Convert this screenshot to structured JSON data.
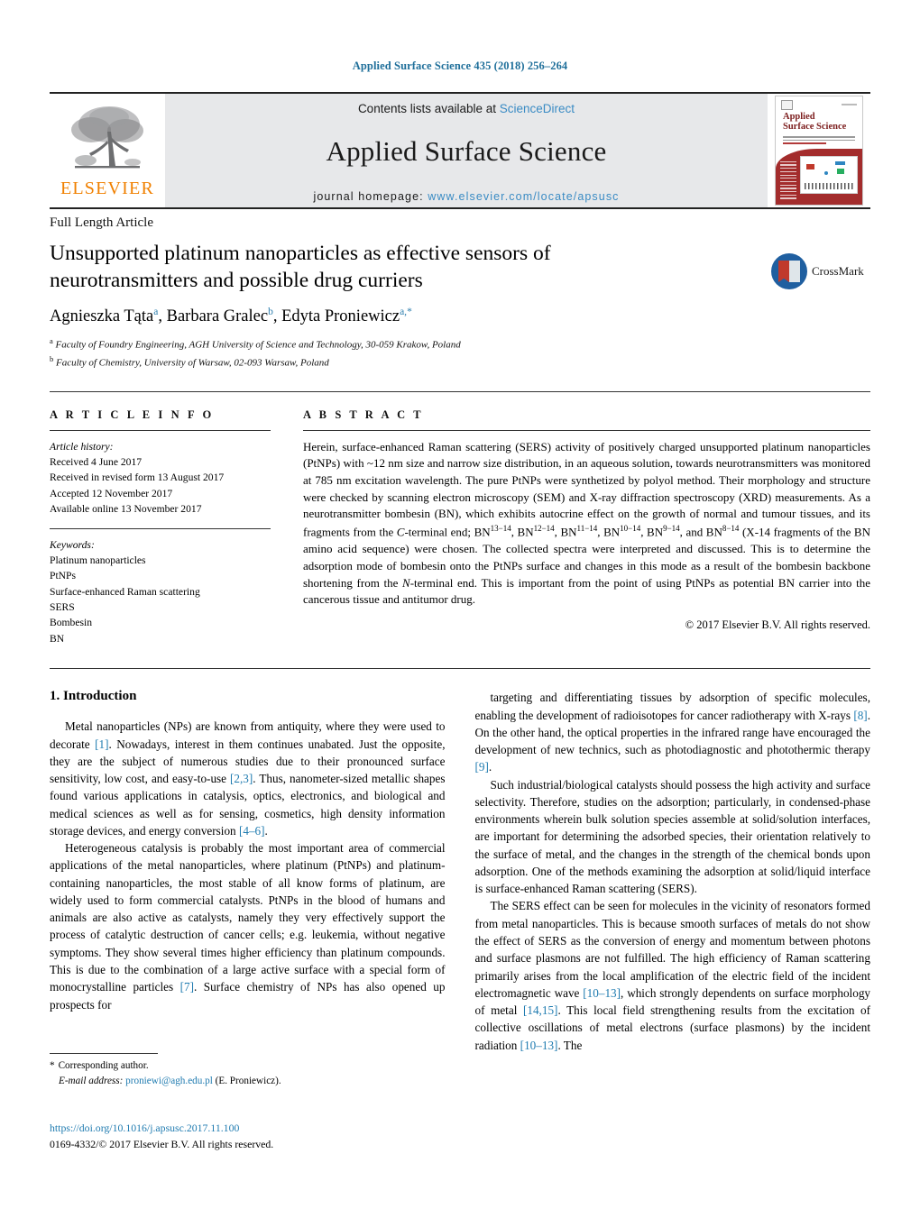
{
  "running_head": "Applied Surface Science 435 (2018) 256–264",
  "masthead": {
    "elsevier_wordmark": "ELSEVIER",
    "contents_prefix": "Contents lists available at ",
    "contents_link": "ScienceDirect",
    "journal_title": "Applied Surface Science",
    "homepage_prefix": "journal homepage: ",
    "homepage_url": "www.elsevier.com/locate/apsusc",
    "cover_title": "Applied\nSurface Science"
  },
  "article": {
    "type": "Full Length Article",
    "title": "Unsupported platinum nanoparticles as effective sensors of neurotransmitters and possible drug curriers",
    "crossmark_label": "CrossMark",
    "authors_html": "Agnieszka Tąta<sup>a</sup>, Barbara Gralec<sup>b</sup>, Edyta Proniewicz<sup>a,</sup><sup>*</sup>",
    "affiliations": [
      "a Faculty of Foundry Engineering, AGH University of Science and Technology, 30-059 Krakow, Poland",
      "b Faculty of Chemistry, University of Warsaw, 02-093 Warsaw, Poland"
    ],
    "affiliation_marks": [
      "a",
      "b"
    ],
    "affiliation_texts": [
      "Faculty of Foundry Engineering, AGH University of Science and Technology, 30-059 Krakow, Poland",
      "Faculty of Chemistry, University of Warsaw, 02-093 Warsaw, Poland"
    ]
  },
  "article_info": {
    "heading": "A R T I C L E   I N F O",
    "history_label": "Article history:",
    "history": [
      "Received 4 June 2017",
      "Received in revised form 13 August 2017",
      "Accepted 12 November 2017",
      "Available online 13 November 2017"
    ],
    "keywords_label": "Keywords:",
    "keywords": [
      "Platinum nanoparticles",
      "PtNPs",
      "Surface-enhanced Raman scattering",
      "SERS",
      "Bombesin",
      "BN"
    ]
  },
  "abstract": {
    "heading": "A B S T R A C T",
    "text_html": "Herein, surface-enhanced Raman scattering (SERS) activity of positively charged unsupported platinum nanoparticles (PtNPs) with ~12 nm size and narrow size distribution, in an aqueous solution, towards neurotransmitters was monitored at 785 nm excitation wavelength. The pure PtNPs were synthetized by polyol method. Their morphology and structure were checked by scanning electron microscopy (SEM) and X-ray diffraction spectroscopy (XRD) measurements. As a neurotransmitter bombesin (BN), which exhibits autocrine effect on the growth of normal and tumour tissues, and its fragments from the <i>C</i>-terminal end; BN<sup>13−14</sup>, BN<sup>12−14</sup>, BN<sup>11−14</sup>, BN<sup>10−14</sup>, BN<sup>9−14</sup>, and BN<sup>8−14</sup> (X-14 fragments of the BN amino acid sequence) were chosen. The collected spectra were interpreted and discussed. This is to determine the adsorption mode of bombesin onto the PtNPs surface and changes in this mode as a result of the bombesin backbone shortening from the <i>N</i>-terminal end. This is important from the point of using PtNPs as potential BN carrier into the cancerous tissue and antitumor drug.",
    "copyright": "© 2017 Elsevier B.V. All rights reserved."
  },
  "introduction": {
    "section_number_title": "1.  Introduction",
    "left_paragraphs_html": [
      "Metal nanoparticles (NPs) are known from antiquity, where they were used to decorate <span class=\"ref\">[1]</span>. Nowadays, interest in them continues unabated. Just the opposite, they are the subject of numerous studies due to their pronounced surface sensitivity, low cost, and easy-to-use <span class=\"ref\">[2,3]</span>. Thus, nanometer-sized metallic shapes found various applications in catalysis, optics, electronics, and biological and medical sciences as well as for sensing, cosmetics, high density information storage devices, and energy conversion <span class=\"ref\">[4–6]</span>.",
      "Heterogeneous catalysis is probably the most important area of commercial applications of the metal nanoparticles, where platinum (PtNPs) and platinum-containing nanoparticles, the most stable of all know forms of platinum, are widely used to form commercial catalysts. PtNPs in the blood of humans and animals are also active as catalysts, namely they very effectively support the process of catalytic destruction of cancer cells; e.g. leukemia, without negative symptoms. They show several times higher efficiency than platinum compounds. This is due to the combination of a large active surface with a special form of monocrystalline particles <span class=\"ref\">[7]</span>. Surface chemistry of NPs has also opened up prospects for"
    ],
    "right_paragraphs_html": [
      "targeting and differentiating tissues by adsorption of specific molecules, enabling the development of radioisotopes for cancer radiotherapy with X-rays <span class=\"ref\">[8]</span>. On the other hand, the optical properties in the infrared range have encouraged the development of new technics, such as photodiagnostic and photothermic therapy <span class=\"ref\">[9]</span>.",
      "Such industrial/biological catalysts should possess the high activity and surface selectivity. Therefore, studies on the adsorption; particularly, in condensed-phase environments wherein bulk solution species assemble at solid/solution interfaces, are important for determining the adsorbed species, their orientation relatively to the surface of metal, and the changes in the strength of the chemical bonds upon adsorption. One of the methods examining the adsorption at solid/liquid interface is surface-enhanced Raman scattering (SERS).",
      "The SERS effect can be seen for molecules in the vicinity of resonators formed from metal nanoparticles. This is because smooth surfaces of metals do not show the effect of SERS as the conversion of energy and momentum between photons and surface plasmons are not fulfilled. The high efficiency of Raman scattering primarily arises from the local amplification of the electric field of the incident electromagnetic wave <span class=\"ref\">[10–13]</span>, which strongly dependents on surface morphology of metal <span class=\"ref\">[14,15]</span>. This local field strengthening results from the excitation of collective oscillations of metal electrons (surface plasmons) by the incident radiation <span class=\"ref\">[10–13]</span>. The"
    ]
  },
  "footer": {
    "corresponding_star": "*",
    "corresponding_label": "Corresponding author.",
    "email_label": "E-mail address:",
    "email": "proniewi@agh.edu.pl",
    "email_owner": "(E. Proniewicz).",
    "doi": "https://doi.org/10.1016/j.apsusc.2017.11.100",
    "issn_line": "0169-4332/© 2017 Elsevier B.V. All rights reserved."
  },
  "colors": {
    "link_blue": "#1f7bb0",
    "header_blue": "#1f6f9a",
    "elsevier_orange": "#F08000",
    "masthead_grey": "#e7e8ea",
    "cover_red": "#a32c2c"
  }
}
